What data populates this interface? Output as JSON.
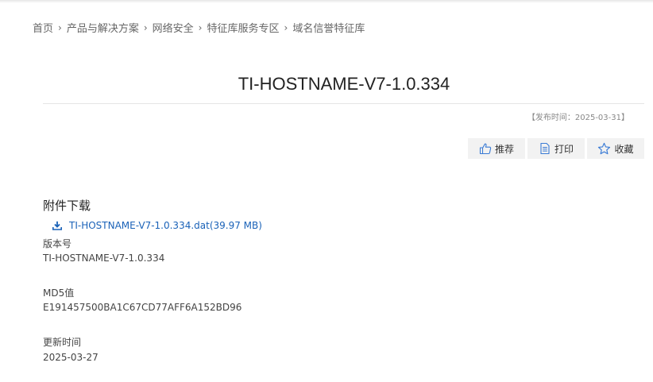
{
  "breadcrumb": {
    "items": [
      "首页",
      "产品与解决方案",
      "网络安全",
      "特征库服务专区",
      "域名信誉特征库"
    ],
    "separator": "›"
  },
  "article": {
    "title": "TI-HOSTNAME-V7-1.0.334",
    "publish_date": "【发布时间：2025-03-31】"
  },
  "actions": {
    "recommend_label": "推荐",
    "print_label": "打印",
    "favorite_label": "收藏"
  },
  "attachments": {
    "heading": "附件下载",
    "file_link": "TI-HOSTNAME-V7-1.0.334.dat(39.97 MB)",
    "icon": "download-icon"
  },
  "fields": {
    "version_label": "版本号",
    "version_value": "TI-HOSTNAME-V7-1.0.334",
    "md5_label": "MD5值",
    "md5_value": "E191457500BA1C67CD77AFF6A152BD96",
    "updated_label": "更新时间",
    "updated_value": "2025-03-27"
  },
  "colors": {
    "link": "#1a62b8",
    "icon": "#3a7bd5",
    "button_bg": "#f2f2f2"
  }
}
